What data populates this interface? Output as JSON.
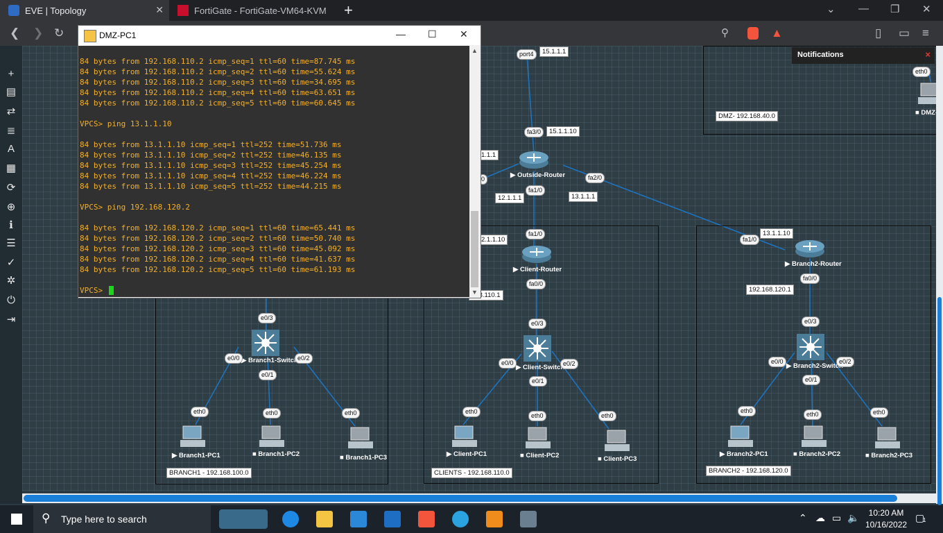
{
  "browser": {
    "tabs": [
      {
        "title": "EVE | Topology"
      },
      {
        "title": "FortiGate - FortiGate-VM64-KVM"
      }
    ],
    "new_tab": "+",
    "badge_count": "1"
  },
  "terminal": {
    "title": "DMZ-PC1",
    "lines": [
      "84 bytes from 192.168.110.2 icmp_seq=1 ttl=60 time=87.745 ms",
      "84 bytes from 192.168.110.2 icmp_seq=2 ttl=60 time=55.624 ms",
      "84 bytes from 192.168.110.2 icmp_seq=3 ttl=60 time=34.695 ms",
      "84 bytes from 192.168.110.2 icmp_seq=4 ttl=60 time=63.651 ms",
      "84 bytes from 192.168.110.2 icmp_seq=5 ttl=60 time=60.645 ms",
      "",
      "VPCS> ping 13.1.1.10",
      "",
      "84 bytes from 13.1.1.10 icmp_seq=1 ttl=252 time=51.736 ms",
      "84 bytes from 13.1.1.10 icmp_seq=2 ttl=252 time=46.135 ms",
      "84 bytes from 13.1.1.10 icmp_seq=3 ttl=252 time=45.254 ms",
      "84 bytes from 13.1.1.10 icmp_seq=4 ttl=252 time=46.224 ms",
      "84 bytes from 13.1.1.10 icmp_seq=5 ttl=252 time=44.215 ms",
      "",
      "VPCS> ping 192.168.120.2",
      "",
      "84 bytes from 192.168.120.2 icmp_seq=1 ttl=60 time=65.441 ms",
      "84 bytes from 192.168.120.2 icmp_seq=2 ttl=60 time=50.740 ms",
      "84 bytes from 192.168.120.2 icmp_seq=3 ttl=60 time=45.092 ms",
      "84 bytes from 192.168.120.2 icmp_seq=4 ttl=60 time=41.637 ms",
      "84 bytes from 192.168.120.2 icmp_seq=5 ttl=60 time=61.193 ms",
      "",
      "VPCS> "
    ]
  },
  "notifications": {
    "title": "Notifications",
    "close": "×"
  },
  "topology": {
    "networks": {
      "dmz": "DMZ- 192.168.40.0",
      "branch1": "BRANCH1 - 192.168.100.0",
      "clients": "CLIENTS - 192.168.110.0",
      "branch2": "BRANCH2 - 192.168.120.0"
    },
    "devices": {
      "outside_router": "Outside-Router",
      "client_router": "Client-Router",
      "branch2_router": "Branch2-Router",
      "branch1_switch": "Branch1-Switch",
      "client_switch": "Client-Switch",
      "branch2_switch": "Branch2-Switch",
      "branch1_pc1": "Branch1-PC1",
      "branch1_pc2": "Branch1-PC2",
      "branch1_pc3": "Branch1-PC3",
      "client_pc1": "Client-PC1",
      "client_pc2": "Client-PC2",
      "client_pc3": "Client-PC3",
      "branch2_pc1": "Branch2-PC1",
      "branch2_pc2": "Branch2-PC2",
      "branch2_pc3": "Branch2-PC3",
      "dmz_pc": "DMZ-"
    },
    "ips": {
      "ip_15_1_1_1": "15.1.1.1",
      "ip_15_1_1_10": "15.1.1.10",
      "ip_11_1_1": "1.1.1",
      "ip_12_1_1_1": "12.1.1.1",
      "ip_13_1_1_1": "13.1.1.1",
      "ip_12_1_1_10": "2.1.1.10",
      "ip_13_1_1_10": "13.1.1.10",
      "ip_168_110_1": "168.110.1",
      "ip_192_168_120_1": "192.168.120.1"
    },
    "interfaces": {
      "port4": "port4",
      "fa3_0": "fa3/0",
      "fa1_0_a": "fa1/0",
      "fa2_0": "fa2/0",
      "fa1_0_b": "fa1/0",
      "fa0_0_a": "fa0/0",
      "fa1_0_c": "fa1/0",
      "fa0_0_b": "fa0/0",
      "dmz_eth0": "eth0",
      "b1_e0_3": "e0/3",
      "b1_e0_0": "e0/0",
      "b1_e0_1": "e0/1",
      "b1_e0_2": "e0/2",
      "c_e0_3": "e0/3",
      "c_e0_0": "e0/0",
      "c_e0_1": "e0/1",
      "c_e0_2": "e0/2",
      "b2_e0_3": "e0/3",
      "b2_e0_0": "e0/0",
      "b2_e0_1": "e0/1",
      "b2_e0_2": "e0/2",
      "eth0": "eth0",
      "partial_0": "0"
    }
  },
  "taskbar": {
    "search_placeholder": "Type here to search",
    "time": "10:20 AM",
    "date": "10/16/2022",
    "notif_count": "1"
  }
}
